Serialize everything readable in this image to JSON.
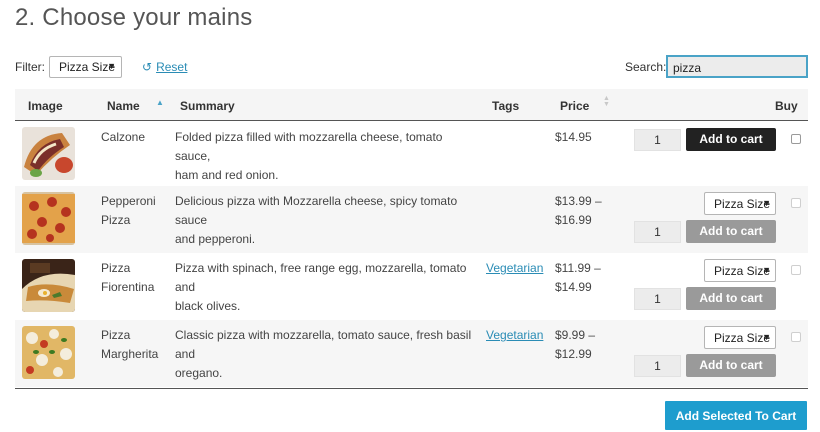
{
  "page": {
    "title": "2. Choose your mains"
  },
  "filter": {
    "label": "Filter:",
    "selected": "Pizza Size",
    "reset_label": "Reset",
    "reset_icon": "undo-icon"
  },
  "search": {
    "label": "Search:",
    "value": "pizza"
  },
  "table": {
    "columns": [
      "Image",
      "Name",
      "Summary",
      "Tags",
      "Price",
      "Buy"
    ],
    "sort": {
      "column": "Name",
      "direction": "ascending"
    },
    "rows": [
      {
        "image": "calzone-photo",
        "name_line1": "Calzone",
        "name_line2": "",
        "summary_line1": "Folded pizza filled with mozzarella cheese, tomato sauce,",
        "summary_line2": "ham and red onion.",
        "tag": "",
        "price_line1": "$14.95",
        "price_line2": "",
        "qty": "1",
        "has_size_select": false,
        "size_label": "",
        "button": "Add to cart",
        "button_state": "active"
      },
      {
        "image": "pepperoni-pizza-photo",
        "name_line1": "Pepperoni",
        "name_line2": "Pizza",
        "summary_line1": "Delicious pizza with Mozzarella cheese, spicy tomato sauce",
        "summary_line2": "and pepperoni.",
        "tag": "",
        "price_line1": "$13.99 –",
        "price_line2": "$16.99",
        "qty": "1",
        "has_size_select": true,
        "size_label": "Pizza Size",
        "button": "Add to cart",
        "button_state": "disabled"
      },
      {
        "image": "pizza-fiorentina-photo",
        "name_line1": "Pizza",
        "name_line2": "Fiorentina",
        "summary_line1": "Pizza with spinach, free range egg, mozzarella, tomato and",
        "summary_line2": "black olives.",
        "tag": "Vegetarian",
        "price_line1": "$11.99 –",
        "price_line2": "$14.99",
        "qty": "1",
        "has_size_select": true,
        "size_label": "Pizza Size",
        "button": "Add to cart",
        "button_state": "disabled"
      },
      {
        "image": "pizza-margherita-photo",
        "name_line1": "Pizza",
        "name_line2": "Margherita",
        "summary_line1": "Classic pizza with mozzarella, tomato sauce, fresh basil and",
        "summary_line2": "oregano.",
        "tag": "Vegetarian",
        "price_line1": "$9.99 –",
        "price_line2": "$12.99",
        "qty": "1",
        "has_size_select": true,
        "size_label": "Pizza Size",
        "button": "Add to cart",
        "button_state": "disabled"
      }
    ]
  },
  "footer": {
    "add_selected_label": "Add Selected To Cart"
  },
  "colors": {
    "accent": "#1e9dce",
    "link": "#2a8cb5",
    "dark_button": "#222222",
    "disabled_button": "#9a9a9a"
  }
}
